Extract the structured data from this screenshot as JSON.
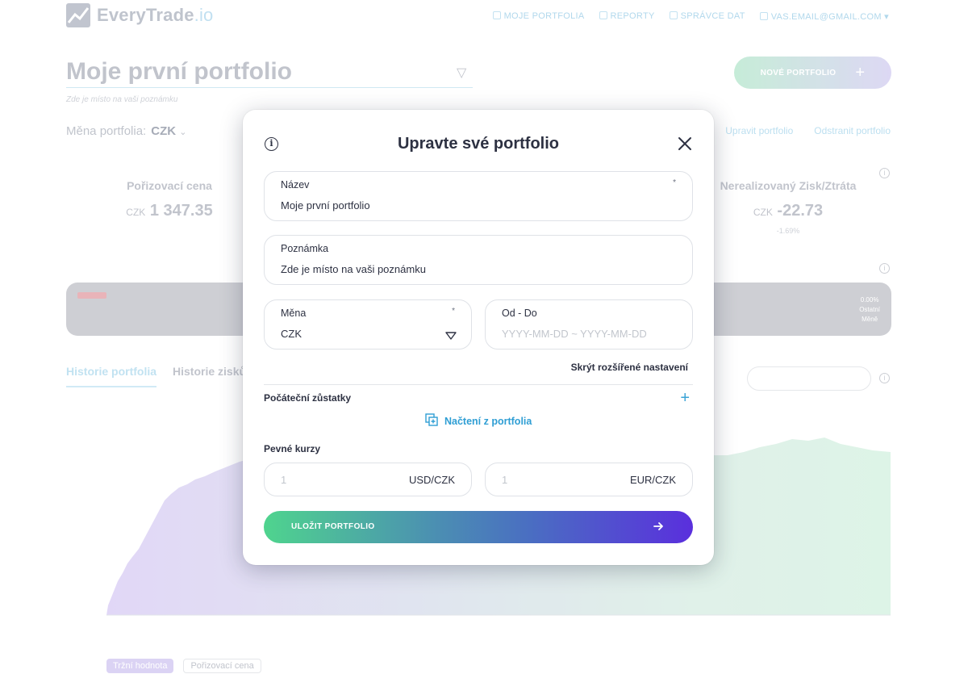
{
  "header": {
    "logo_text": "EveryTrade",
    "logo_suffix": ".io",
    "nav": [
      "MOJE PORTFOLIA",
      "REPORTY",
      "SPRÁVCE DAT",
      "VAS.EMAIL@GMAIL.COM"
    ]
  },
  "portfolio": {
    "title": "Moje první portfolio",
    "note": "Zde je místo na vaši poznámku",
    "new_button": "NOVÉ PORTFOLIO",
    "currency_label": "Měna portfolia:",
    "currency_value": "CZK",
    "links": [
      "Upravit portfolio",
      "Odstranit portfolio"
    ]
  },
  "stats": {
    "purchase_label": "Pořizovací cena",
    "purchase_currency": "CZK",
    "purchase_value": "1 347.35",
    "unrealized_label": "Nerealizovaný Zisk/Ztráta",
    "unrealized_currency": "CZK",
    "unrealized_value": "-22.73",
    "unrealized_pct": "-1.69%"
  },
  "band": {
    "right_pct": "0.00%",
    "right_line1": "Ostatní",
    "right_line2": "Měně"
  },
  "tabs": [
    "Historie portfolia",
    "Historie zisků"
  ],
  "legend": [
    "Tržní hodnota",
    "Pořizovací cena"
  ],
  "modal": {
    "title": "Upravte své portfolio",
    "name_label": "Název",
    "name_value": "Moje první portfolio",
    "note_label": "Poznámka",
    "note_value": "Zde je místo na vaši poznámku",
    "currency_label": "Měna",
    "currency_value": "CZK",
    "range_label": "Od - Do",
    "range_placeholder": "YYYY-MM-DD ~ YYYY-MM-DD",
    "required_mark": "*",
    "hide_advanced": "Skrýt rozšířené nastavení",
    "initial_balances": "Počáteční zůstatky",
    "load_from_portfolio": "Načtení z portfolia",
    "fixed_rates": "Pevné kurzy",
    "rates": [
      {
        "value": "1",
        "pair": "USD/CZK"
      },
      {
        "value": "1",
        "pair": "EUR/CZK"
      }
    ],
    "save_button": "ULOŽIT PORTFOLIO"
  },
  "colors": {
    "accent_blue": "#2f9ed4",
    "gradient_start": "#4fd48e",
    "gradient_end": "#5a2fdd",
    "text_dark": "#2d3142"
  }
}
